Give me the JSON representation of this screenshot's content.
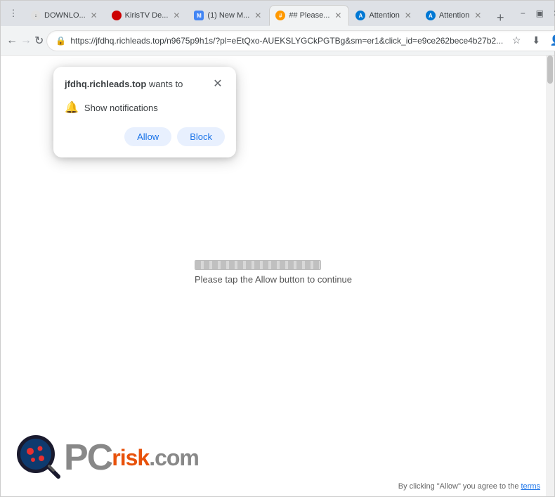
{
  "browser": {
    "tabs": [
      {
        "id": "tab-dl",
        "label": "DOWNLO...",
        "active": false,
        "favicon": "dl"
      },
      {
        "id": "tab-kiris",
        "label": "KirisTV De...",
        "active": false,
        "favicon": "kiris"
      },
      {
        "id": "tab-new",
        "label": "(1) New M...",
        "active": false,
        "favicon": "new"
      },
      {
        "id": "tab-hash",
        "label": "## Please...",
        "active": true,
        "favicon": "hash"
      },
      {
        "id": "tab-attn1",
        "label": "Attention",
        "active": false,
        "favicon": "attn"
      },
      {
        "id": "tab-attn2",
        "label": "Attention",
        "active": false,
        "favicon": "attn2"
      }
    ],
    "url": "https://jfdhq.richleads.top/n9675p9h1s/?pl=eEtQxo-AUEKSLYGCkPGTBg&sm=er1&click_id=e9ce262bece4b27b2...",
    "back_disabled": false,
    "forward_disabled": true
  },
  "popup": {
    "title_domain": "jfdhq.richleads.top",
    "title_suffix": " wants to",
    "notification_label": "Show notifications",
    "allow_label": "Allow",
    "block_label": "Block"
  },
  "page": {
    "progress_text": "Please tap the Allow button to continue",
    "logo_pc": "PC",
    "logo_risk": "risk",
    "logo_dotcom": ".com",
    "disclaimer": "By clicking \"Allow\" you agree to the",
    "terms_label": "terms"
  }
}
